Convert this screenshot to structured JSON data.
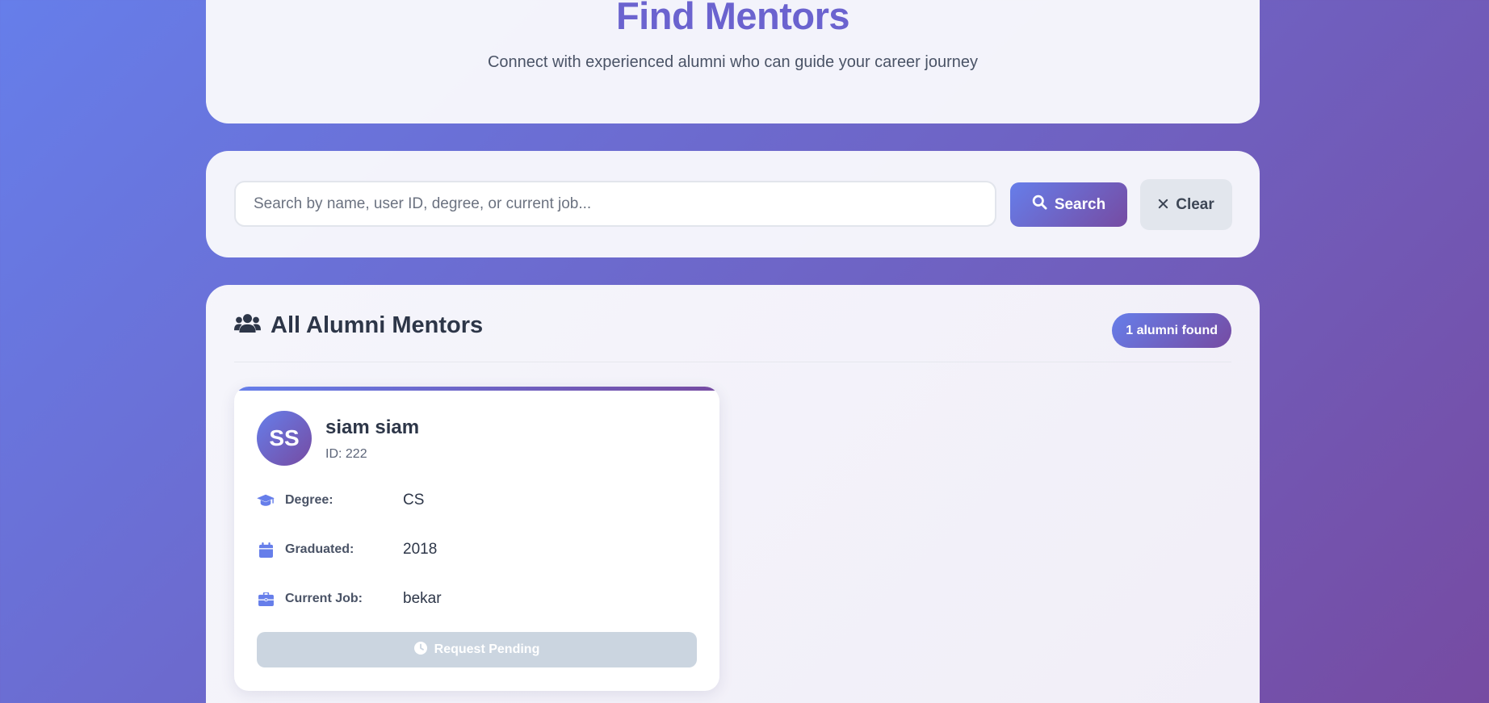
{
  "hero": {
    "title": "Find Mentors",
    "subtitle": "Connect with experienced alumni who can guide your career journey"
  },
  "search": {
    "placeholder": "Search by name, user ID, degree, or current job...",
    "value": "",
    "search_label": "Search",
    "clear_label": "Clear"
  },
  "results": {
    "title": "All Alumni Mentors",
    "count_badge": "1 alumni found",
    "icon": "users-icon"
  },
  "mentors": [
    {
      "initials": "SS",
      "name": "siam siam",
      "id": "ID: 222",
      "degree_label": "Degree:",
      "degree": "CS",
      "graduated_label": "Graduated:",
      "graduated": "2018",
      "job_label": "Current Job:",
      "job": "bekar",
      "action_label": "Request Pending"
    }
  ],
  "colors": {
    "accent_start": "#667eea",
    "accent_end": "#764ba2",
    "pending_button": "#cbd5e0"
  }
}
